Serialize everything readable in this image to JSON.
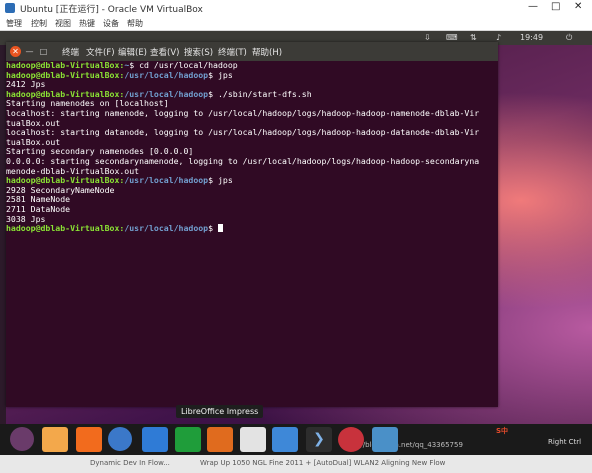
{
  "host": {
    "title": "Ubuntu [正在运行] - Oracle VM VirtualBox",
    "menu": [
      "管理",
      "控制",
      "视图",
      "热键",
      "设备",
      "帮助"
    ],
    "win_controls": [
      "—",
      "□",
      "✕"
    ]
  },
  "ubuntu_bar": {
    "time": "19:49"
  },
  "terminal": {
    "menu": [
      "终端",
      "文件(F)",
      "编辑(E)",
      "查看(V)",
      "搜索(S)",
      "终端(T)",
      "帮助(H)"
    ],
    "prompt_user": "hadoop@dblab-VirtualBox",
    "lines": [
      {
        "type": "cmd",
        "path": "~",
        "cmd": "cd /usr/local/hadoop"
      },
      {
        "type": "cmd",
        "path": "/usr/local/hadoop",
        "cmd": "jps"
      },
      {
        "type": "out",
        "text": "2412 Jps"
      },
      {
        "type": "cmd",
        "path": "/usr/local/hadoop",
        "cmd": "./sbin/start-dfs.sh"
      },
      {
        "type": "out",
        "text": "Starting namenodes on [localhost]"
      },
      {
        "type": "out",
        "text": "localhost: starting namenode, logging to /usr/local/hadoop/logs/hadoop-hadoop-namenode-dblab-Vir"
      },
      {
        "type": "out",
        "text": "tualBox.out"
      },
      {
        "type": "out",
        "text": "localhost: starting datanode, logging to /usr/local/hadoop/logs/hadoop-hadoop-datanode-dblab-Vir"
      },
      {
        "type": "out",
        "text": "tualBox.out"
      },
      {
        "type": "out",
        "text": "Starting secondary namenodes [0.0.0.0]"
      },
      {
        "type": "out",
        "text": "0.0.0.0: starting secondarynamenode, logging to /usr/local/hadoop/logs/hadoop-hadoop-secondaryna"
      },
      {
        "type": "out",
        "text": "menode-dblab-VirtualBox.out"
      },
      {
        "type": "cmd",
        "path": "/usr/local/hadoop",
        "cmd": "jps"
      },
      {
        "type": "out",
        "text": "2928 SecondaryNameNode"
      },
      {
        "type": "out",
        "text": "2581 NameNode"
      },
      {
        "type": "out",
        "text": "2711 DataNode"
      },
      {
        "type": "out",
        "text": "3038 Jps"
      },
      {
        "type": "prompt",
        "path": "/usr/local/hadoop",
        "cmd": ""
      }
    ]
  },
  "tooltip": "LibreOffice Impress",
  "dock": {
    "icons": [
      "ubuntu-icon",
      "files-icon",
      "firefox-icon",
      "chromium-icon",
      "writer-icon",
      "calc-icon",
      "impress-icon",
      "software-icon",
      "help-icon",
      "terminal-icon",
      "recorder-icon",
      "workspace-icon"
    ],
    "colors": [
      "#6a3b6a",
      "#f3a84b",
      "#f26b1d",
      "#3b78c9",
      "#2f7bd6",
      "#1f9d3a",
      "#e06b1e",
      "#e3e3e3",
      "#3e88d8",
      "#2d2d2d",
      "#c8323c",
      "#4a90c8"
    ],
    "tray_text": "Right Ctrl",
    "watermark": "https://blog.csdn.net/qq_43365759"
  },
  "windows_taskbar": {
    "items": [
      "Dynamic Dev In Flow... ",
      "Wrap Up 1050 NGL Fine 2011 + [AutoDual] WLAN2 Aligning New Flow"
    ]
  }
}
